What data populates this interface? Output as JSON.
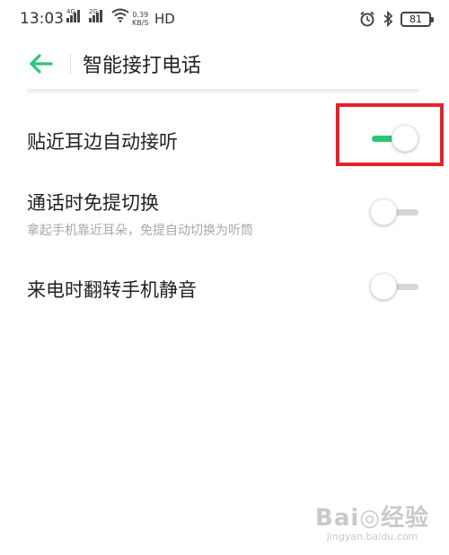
{
  "status_bar": {
    "time": "13:03",
    "sim1_tag": "4G",
    "sim2_tag": "2G",
    "speed_value": "0.39",
    "speed_unit": "KB/S",
    "hd": "HD",
    "battery": "81"
  },
  "app_bar": {
    "back_icon": "arrow-left-icon",
    "title": "智能接打电话"
  },
  "settings": [
    {
      "title": "贴近耳边自动接听",
      "subtitle": "",
      "enabled": true
    },
    {
      "title": "通话时免提切换",
      "subtitle": "拿起手机靠近耳朵，免提自动切换为听筒",
      "enabled": false
    },
    {
      "title": "来电时翻转手机静音",
      "subtitle": "",
      "enabled": false
    }
  ],
  "watermark": {
    "main": "Bai◎经验",
    "sub": "jingyan.baidu.com"
  },
  "colors": {
    "accent": "#2ec579",
    "highlight": "#e8202a",
    "subtitle": "#a8a8a8"
  }
}
